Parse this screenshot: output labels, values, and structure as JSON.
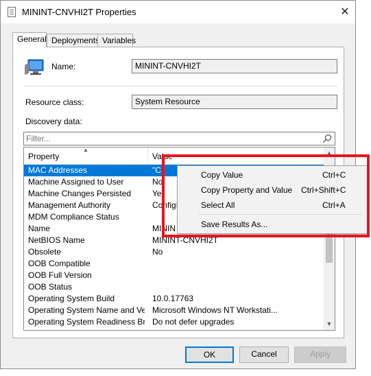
{
  "window": {
    "title": "MININT-CNVHI2T Properties"
  },
  "tabs": [
    {
      "label": "General",
      "active": true
    },
    {
      "label": "Deployments",
      "active": false
    },
    {
      "label": "Variables",
      "active": false
    }
  ],
  "general": {
    "name_label": "Name:",
    "name_value": "MININT-CNVHI2T",
    "resource_class_label": "Resource class:",
    "resource_class_value": "System Resource",
    "discovery_label": "Discovery data:",
    "filter_placeholder": "Filter..."
  },
  "list": {
    "columns": [
      "Property",
      "Value"
    ],
    "rows": [
      {
        "property": "MAC Addresses",
        "value": "\"C:",
        "selected": true
      },
      {
        "property": "Machine Assigned to User",
        "value": "No",
        "selected": false
      },
      {
        "property": "Machine Changes Persisted",
        "value": "Ye",
        "selected": false
      },
      {
        "property": "Management Authority",
        "value": "ConfigM",
        "selected": false
      },
      {
        "property": "MDM Compliance Status",
        "value": "",
        "selected": false
      },
      {
        "property": "Name",
        "value": "MININ",
        "selected": false
      },
      {
        "property": "NetBIOS Name",
        "value": "MININT-CNVHI2T",
        "selected": false
      },
      {
        "property": "Obsolete",
        "value": "No",
        "selected": false
      },
      {
        "property": "OOB Compatible",
        "value": "",
        "selected": false
      },
      {
        "property": "OOB Full Version",
        "value": "",
        "selected": false
      },
      {
        "property": "OOB Status",
        "value": "",
        "selected": false
      },
      {
        "property": "Operating System Build",
        "value": "10.0.17763",
        "selected": false
      },
      {
        "property": "Operating System Name and Versi...",
        "value": "Microsoft Windows NT Workstati...",
        "selected": false
      },
      {
        "property": "Operating System Readiness Bran...",
        "value": "Do not defer upgrades",
        "selected": false
      }
    ]
  },
  "context_menu": {
    "items": [
      {
        "label": "Copy Value",
        "shortcut": "Ctrl+C"
      },
      {
        "label": "Copy Property and Value",
        "shortcut": "Ctrl+Shift+C"
      },
      {
        "label": "Select All",
        "shortcut": "Ctrl+A"
      },
      {
        "label": "Save Results As...",
        "shortcut": ""
      }
    ]
  },
  "buttons": {
    "ok": "OK",
    "cancel": "Cancel",
    "apply": "Apply"
  },
  "colors": {
    "selection": "#0078d7",
    "highlight_box": "#e8141d"
  },
  "icons": {
    "window": "properties-page-icon",
    "computer": "computer-icon",
    "search": "search-icon",
    "close": "close-icon"
  }
}
